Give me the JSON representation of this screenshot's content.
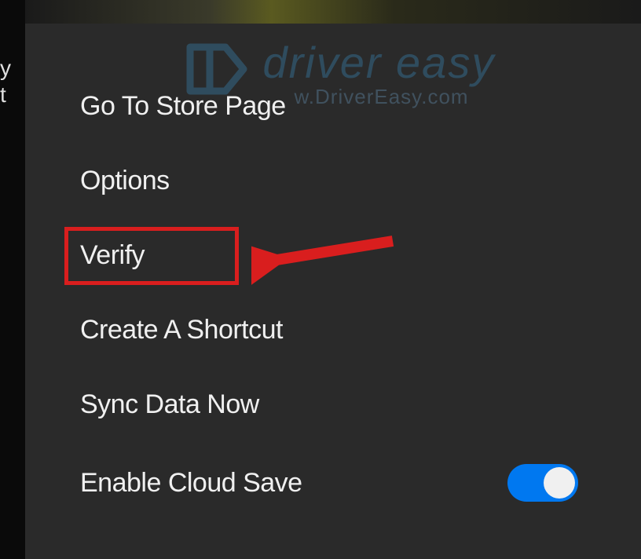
{
  "leftEdge": {
    "line1": "y",
    "line2": "t"
  },
  "watermark": {
    "title": "driver easy",
    "subtitle": "w.DriverEasy.com"
  },
  "menu": {
    "items": [
      {
        "label": "Go To Store Page"
      },
      {
        "label": "Options"
      },
      {
        "label": "Verify"
      },
      {
        "label": "Create A Shortcut"
      },
      {
        "label": "Sync Data Now"
      },
      {
        "label": "Enable Cloud Save"
      }
    ]
  },
  "toggle": {
    "enabled": true
  }
}
